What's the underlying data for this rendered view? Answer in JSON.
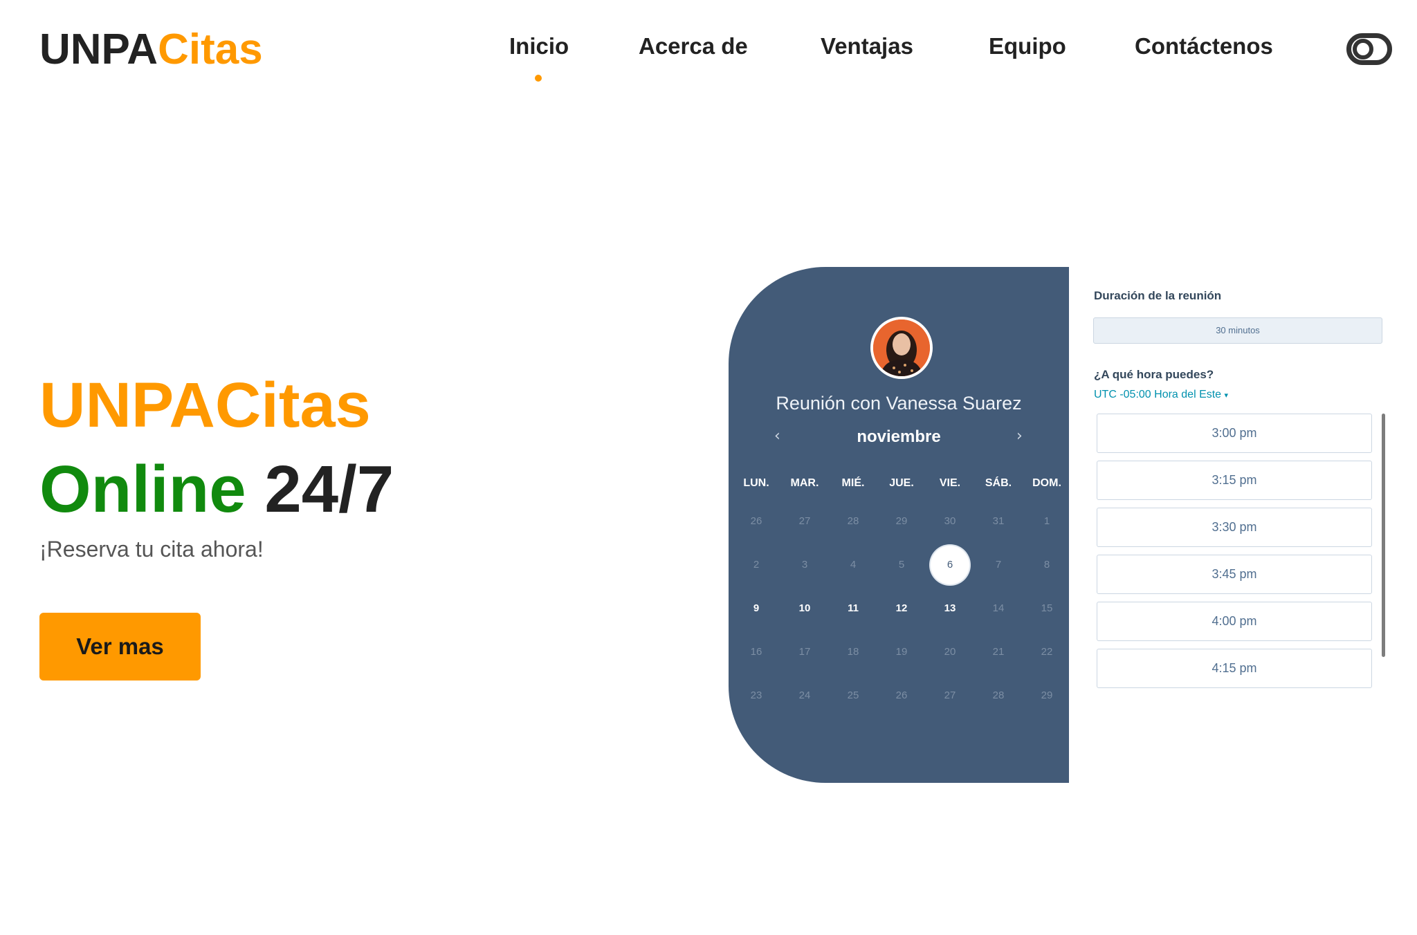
{
  "brand": {
    "part1": "UNPA",
    "part2": "Citas"
  },
  "nav": {
    "items": [
      {
        "label": "Inicio",
        "active": true
      },
      {
        "label": "Acerca de"
      },
      {
        "label": "Ventajas"
      },
      {
        "label": "Equipo"
      },
      {
        "label": "Contáctenos"
      }
    ]
  },
  "theme_toggle": {
    "icon": "toggle-icon"
  },
  "hero": {
    "title": "UNPACitas",
    "subtitle_green": "Online",
    "subtitle_dark": "24/7",
    "tagline": "¡Reserva tu cita ahora!",
    "cta": "Ver mas"
  },
  "booking": {
    "meeting_title": "Reunión con Vanessa Suarez",
    "month": "noviembre",
    "prev_icon": "chevron-left-icon",
    "next_icon": "chevron-right-icon",
    "weekdays": [
      "LUN.",
      "MAR.",
      "MIÉ.",
      "JUE.",
      "VIE.",
      "SÁB.",
      "DOM."
    ],
    "weeks": [
      [
        "26",
        "27",
        "28",
        "29",
        "30",
        "31",
        "1"
      ],
      [
        "2",
        "3",
        "4",
        "5",
        "6",
        "7",
        "8"
      ],
      [
        "9",
        "10",
        "11",
        "12",
        "13",
        "14",
        "15"
      ],
      [
        "16",
        "17",
        "18",
        "19",
        "20",
        "21",
        "22"
      ],
      [
        "23",
        "24",
        "25",
        "26",
        "27",
        "28",
        "29"
      ]
    ],
    "selected_day": "6",
    "available_days": [
      "9",
      "10",
      "11",
      "12",
      "13"
    ],
    "duration_label": "Duración de la reunión",
    "duration_value": "30 minutos",
    "time_question": "¿A qué hora puedes?",
    "timezone": "UTC -05:00 Hora del Este",
    "slots": [
      "3:00 pm",
      "3:15 pm",
      "3:30 pm",
      "3:45 pm",
      "4:00 pm",
      "4:15 pm"
    ]
  },
  "colors": {
    "accent": "#ff9900",
    "green": "#118a0e",
    "calendar_bg": "#435b78",
    "link": "#0091ae"
  }
}
